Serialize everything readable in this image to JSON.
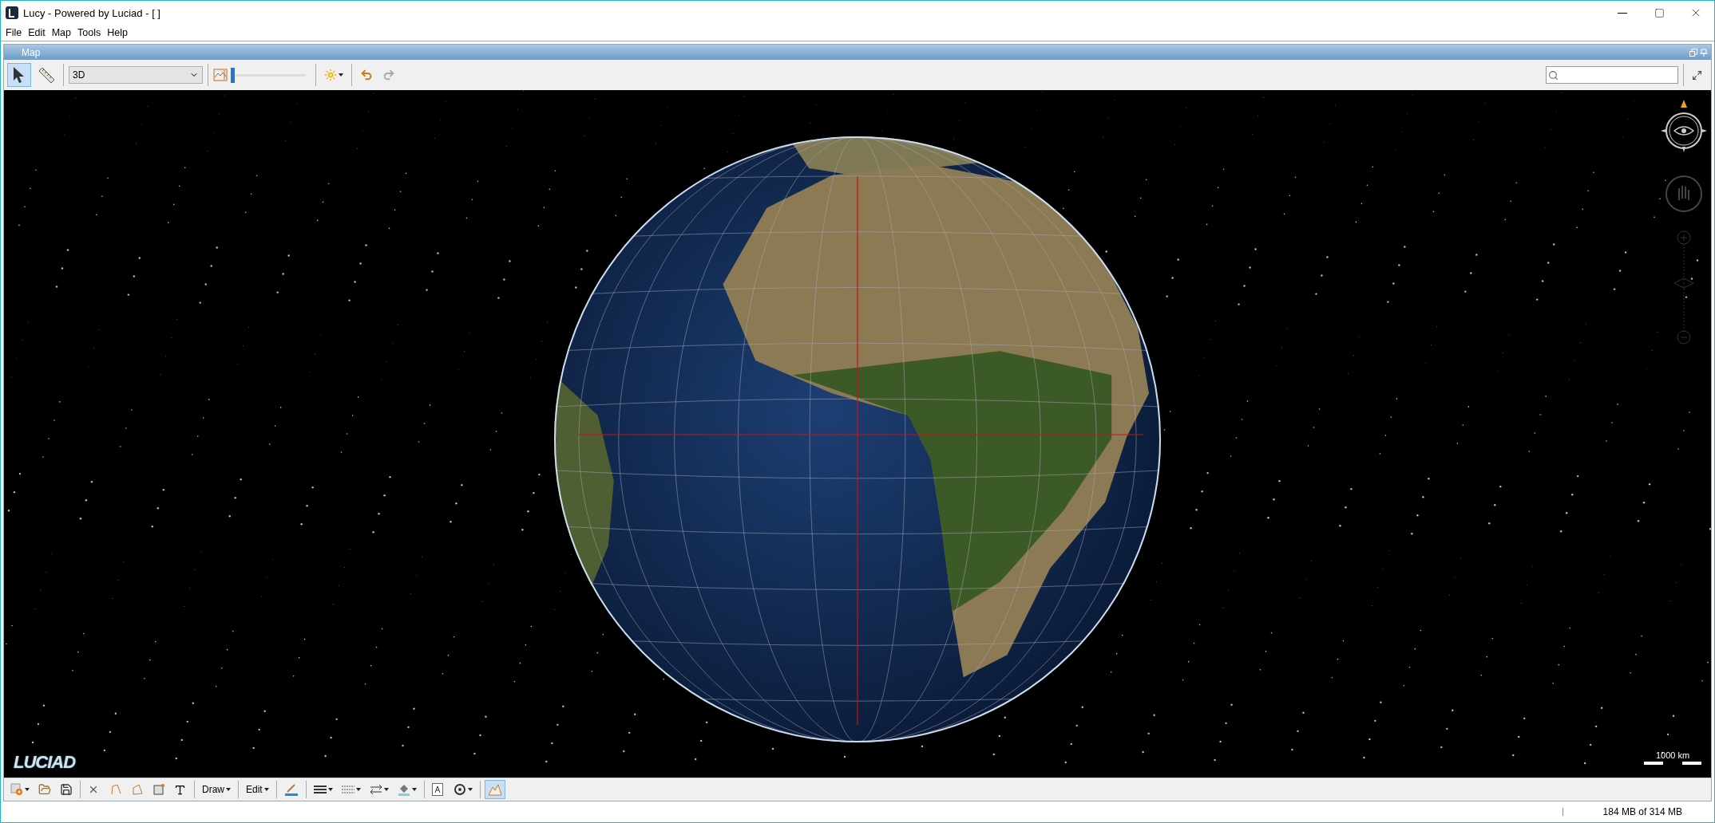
{
  "window": {
    "title": "Lucy - Powered by Luciad - [  ]"
  },
  "menu": [
    "File",
    "Edit",
    "Map",
    "Tools",
    "Help"
  ],
  "panel": {
    "title": "Map"
  },
  "map_toolbar": {
    "tools": [
      {
        "kind": "select",
        "selected": true
      },
      {
        "kind": "ruler",
        "selected": false
      }
    ],
    "view_mode": "3D",
    "slider": {
      "level": 0.0
    }
  },
  "map": {
    "logo": "LUCIAD",
    "scale_label": "1000 km"
  },
  "draw_toolbar": {
    "menus": [
      "Draw",
      "Edit"
    ],
    "terrain_selected": true
  },
  "status_bar": {
    "memory": "184 MB of 314 MB"
  }
}
